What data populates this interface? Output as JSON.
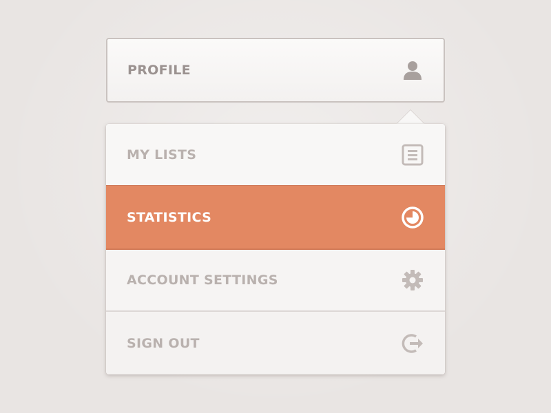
{
  "profile": {
    "label": "PROFILE",
    "icon": "user-icon"
  },
  "menu": {
    "items": [
      {
        "label": "MY LISTS",
        "icon": "list-icon",
        "active": false
      },
      {
        "label": "STATISTICS",
        "icon": "pie-chart-icon",
        "active": true
      },
      {
        "label": "ACCOUNT SETTINGS",
        "icon": "gear-icon",
        "active": false
      },
      {
        "label": "SIGN OUT",
        "icon": "sign-out-icon",
        "active": false
      }
    ]
  },
  "colors": {
    "background": "#e9e5e3",
    "accent": "#e38862",
    "text_muted": "#b9b1ae",
    "text_profile": "#9b9290"
  }
}
